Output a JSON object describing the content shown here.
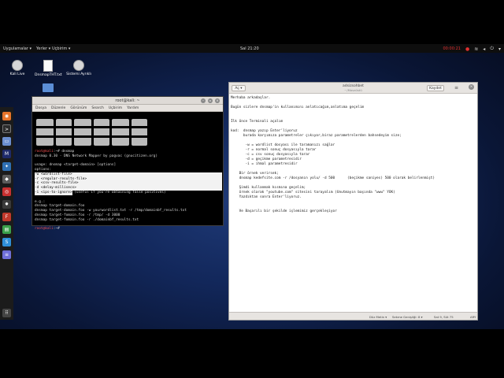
{
  "panel": {
    "applications": "Uygulamalar ▾",
    "places": "Yerler ▾",
    "app_menu": "Uçbirim ▾",
    "clock": "Sal 21:20",
    "recording": "00:00:21"
  },
  "desktop": {
    "icons": [
      {
        "label": "Kali Live"
      },
      {
        "label": "DnsmapTHT.txt"
      },
      {
        "label": "Sistemi Ayrıklı"
      },
      {
        "label": ""
      }
    ]
  },
  "terminal": {
    "title": "root@kali: ~",
    "menu": [
      "Dosya",
      "Düzenle",
      "Görünüm",
      "Search",
      "Uçbirim",
      "Yardım"
    ],
    "prompt1": "root@kali",
    "cmd1": ":~# dnsmap",
    "line_version": "dnsmap 0.30 - DNS Network Mapper by pagvac (gnucitizen.org)",
    "line_usage": "usage: dnsmap <target-domain> [options]",
    "line_options": "options:",
    "opt_w": "-w <wordlist-file>",
    "opt_r": "-r <regular-results-file>",
    "opt_c": "-c <csv-results-file>",
    "opt_d": "-d <delay-millisecs>",
    "opt_i": "-i <ips-to-ignore>",
    "opt_i_note": " (useful if you're obtaining false positives)",
    "line_eg": "e.g.:",
    "ex1": "dnsmap target-domain.foo",
    "ex2": "dnsmap target-domain.foo -w yourwordlist.txt -r /tmp/domainbf_results.txt",
    "ex3": "dnsmap target-fomain.foo -r /tmp/ -d 3000",
    "ex4": "dnsmap target-fomain.foo -r ./domainbf_results.txt",
    "prompt2": "root@kali",
    "cmd2": ":~# "
  },
  "editor": {
    "open_label": "Aç ▾",
    "title": "adsizsohbet",
    "subtitle": "~/Masaüstü",
    "save_label": "Kaydet",
    "lines": [
      "Merhaba arkadaşlar.",
      "",
      "Bugün sizlere dnsmap'in kullanımını anlatıcağım,anlatıma geçelim",
      "",
      "",
      "İlk önce Terminali açalım",
      "",
      "kod:  dnsmap yazıp Enter'liyoruz",
      "      burada karşımıza parametreler çıkıyor,biraz parametrelerden bahsedeyim size;",
      "",
      "       -w = wordlist dosyası ile taramanızı sağlar",
      "       -r = normal sonuç dosyasıyla tarar",
      "       -c = csv sonuç dosyasıyla tarar",
      "       -d = geçikme parametresidir",
      "       -i = ihmal parametresidir",
      "",
      "    Bir örnek verirsek;",
      "    dnsmap kedefsite.com -r /dosyanın yolu/ -d 500      (beçikme saniyes) 500 olarak belirlenmişt)",
      "",
      "    Şimdi kullanmak kısmına geçelim;",
      "    örnek olarak \"youtube.com\" sitesini tarayalım (Unutmayın başında \"www\" YOK)",
      "    Yazdıktan sonra Enter'liyoruz.",
      "",
      "",
      "    Ve Başarılı bir şekilde işlemimiz gerçekleşiyor"
    ],
    "status": {
      "mode": "Düz Metin ▾",
      "tab": "Sekme Genişliği: 8 ▾",
      "position": "Sat 9, Süt 75",
      "ins": "ARY"
    }
  }
}
